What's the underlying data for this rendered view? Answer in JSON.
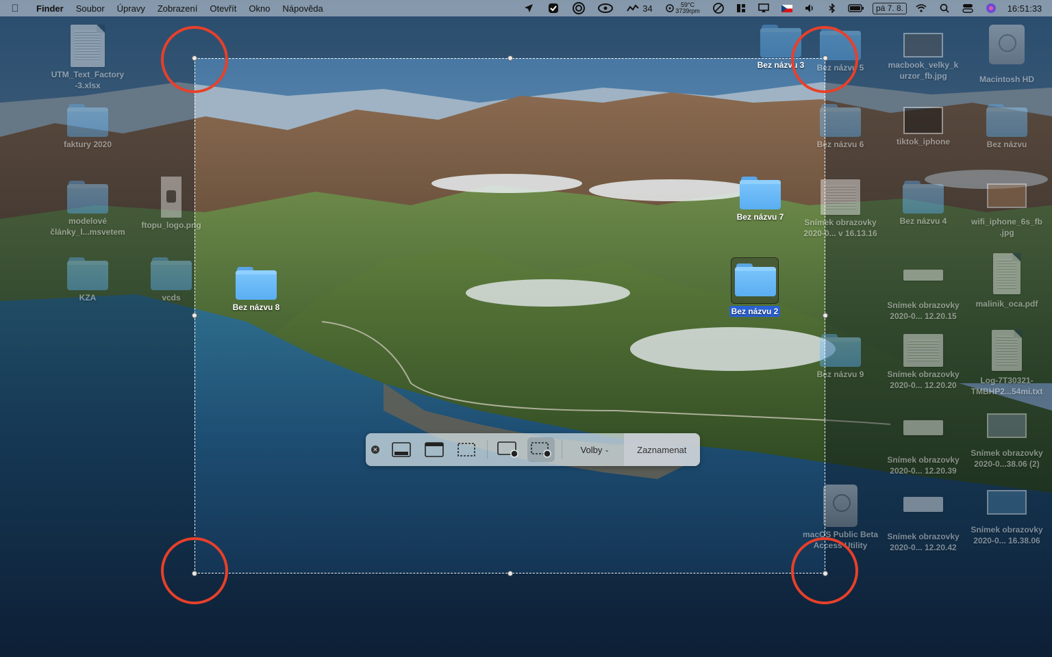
{
  "menubar": {
    "app_name": "Finder",
    "menus": [
      "Soubor",
      "Úpravy",
      "Zobrazení",
      "Otevřít",
      "Okno",
      "Nápověda"
    ],
    "status_items": {
      "stats_count": "34",
      "temperature": "59°C",
      "fan_speed": "3739rpm",
      "date": "pá 7. 8.",
      "time": "16:51:33"
    }
  },
  "desktop_icons": {
    "utm": "UTM_Text_Factory\n-3.xlsx",
    "faktury": "faktury 2020",
    "modelove": "modelové\nčlánky_l...msvetem",
    "ftopu": "ftopu_logo.png",
    "kza": "KZA",
    "vcds": "vcds",
    "bez8": "Bez názvu 8",
    "bez3": "Bez názvu 3",
    "bez5": "Bez názvu 5",
    "macbook": "macbook_velky_k\nurzor_fb.jpg",
    "macintosh": "Macintosh HD",
    "bez6": "Bez názvu 6",
    "tiktok": "tiktok_iphone",
    "beznazvu": "Bez názvu",
    "bez7": "Bez názvu 7",
    "snimek1": "Snímek obrazovky\n2020-0... v 16.13.16",
    "bez4": "Bez názvu 4",
    "wifi": "wifi_iphone_6s_fb\n.jpg",
    "bez2": "Bez názvu 2",
    "snimek2": "Snímek obrazovky\n2020-0... 12.20.15",
    "malinik": "malinik_oca.pdf",
    "bez9": "Bez názvu 9",
    "snimek3": "Snímek obrazovky\n2020-0... 12.20.20",
    "log": "Log-7T30321-\nTMBHP2...54mi.txt",
    "snimek4": "Snímek obrazovky\n2020-0... 12.20.39",
    "snimek5": "Snímek obrazovky\n2020-0...38.06 (2)",
    "macos_beta": "macOS Public Beta\nAccess Utility",
    "snimek6": "Snímek obrazovky\n2020-0... 12.20.42",
    "snimek7": "Snímek obrazovky\n2020-0... 16.38.06"
  },
  "toolbar": {
    "options_label": "Volby",
    "record_label": "Zaznamenat"
  },
  "colors": {
    "annotation_ring": "#e8402a",
    "selected_label": "#2a62d6"
  }
}
